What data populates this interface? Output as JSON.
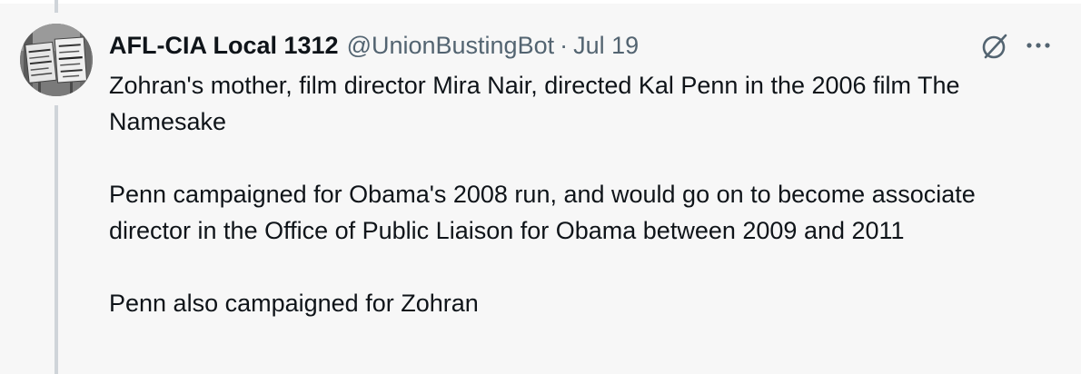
{
  "tweet": {
    "author": {
      "display_name": "AFL-CIA Local 1312",
      "handle": "@UnionBustingBot",
      "avatar_icon": "protest-signs-photo",
      "avatar_sign_texts": [
        "DEFEAT",
        "DEFEAT",
        "CONSPIRACY",
        "TO DESTROY",
        "UNIONS"
      ]
    },
    "separator": "·",
    "date": "Jul 19",
    "paragraphs": [
      "Zohran's mother, film director Mira Nair, directed Kal Penn in the 2006 film The Namesake",
      "Penn campaigned for Obama's 2008 run, and would go on to become associate director in the Office of Public Liaison for Obama between 2009 and 2011",
      "Penn also campaigned for Zohran"
    ],
    "actions": {
      "no_entry_icon": "circle-slash-icon",
      "more_icon": "ellipsis-icon"
    }
  },
  "colors": {
    "text_primary": "#0f1419",
    "text_secondary": "#536471",
    "background": "#f7f7f7",
    "thread_line": "#cfd4d9"
  }
}
